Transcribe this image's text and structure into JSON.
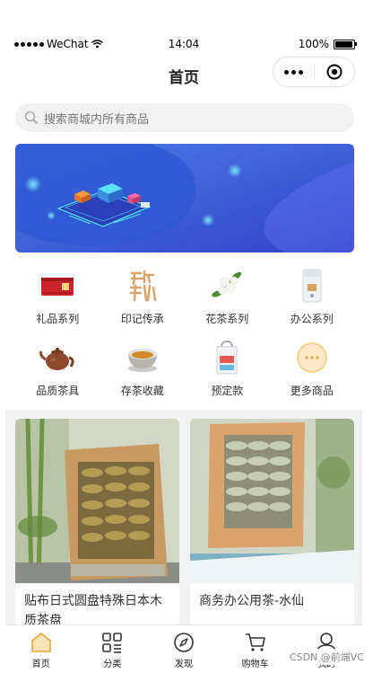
{
  "status_bar": {
    "carrier": "WeChat",
    "time": "14:04",
    "battery": "100%"
  },
  "nav": {
    "title": "首页"
  },
  "search": {
    "placeholder": "搜索商城内所有商品"
  },
  "categories": [
    {
      "label": "礼品系列",
      "icon": "red-gift-box-icon"
    },
    {
      "label": "印记传承",
      "icon": "calligraphy-seal-icon"
    },
    {
      "label": "花茶系列",
      "icon": "jasmine-flower-icon"
    },
    {
      "label": "办公系列",
      "icon": "tea-bag-package-icon"
    },
    {
      "label": "品质茶具",
      "icon": "clay-teapot-icon"
    },
    {
      "label": "存茶收藏",
      "icon": "tea-bowl-icon"
    },
    {
      "label": "预定款",
      "icon": "paper-bag-icon"
    },
    {
      "label": "更多商品",
      "icon": "more-dots-icon"
    }
  ],
  "products": [
    {
      "title": "贴布日式圆盘特殊日本木质茶盘"
    },
    {
      "title": "商务办公用茶-水仙"
    }
  ],
  "tabbar": [
    {
      "label": "首页",
      "icon": "home-icon",
      "active": true
    },
    {
      "label": "分类",
      "icon": "category-grid-icon"
    },
    {
      "label": "发现",
      "icon": "compass-icon"
    },
    {
      "label": "购物车",
      "icon": "cart-icon"
    },
    {
      "label": "我的",
      "icon": "user-icon"
    }
  ],
  "watermark": "CSDN @前端VC",
  "colors": {
    "banner_blue": "#3f5fd8",
    "tab_active": "#e8a735",
    "page_bg": "#f2f2f2"
  }
}
